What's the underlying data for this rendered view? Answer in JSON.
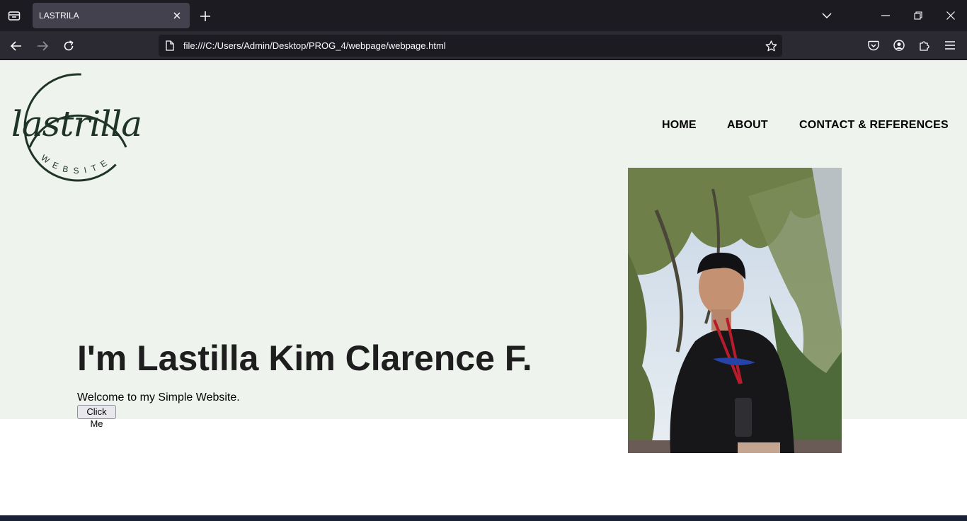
{
  "browser": {
    "tab_title": "LASTRILA",
    "url": "file:///C:/Users/Admin/Desktop/PROG_4/webpage/webpage.html",
    "icons": [
      "list-all-tabs-icon",
      "close-tab-icon",
      "new-tab-icon",
      "tab-overflow-icon",
      "minimize-icon",
      "restore-icon",
      "close-window-icon",
      "back-icon",
      "forward-icon",
      "reload-icon",
      "page-icon",
      "bookmark-star-icon",
      "pocket-icon",
      "account-icon",
      "extensions-icon",
      "menu-icon"
    ]
  },
  "page": {
    "logo": {
      "script": "lastrilla",
      "sub": "WEBSITE"
    },
    "nav": [
      "HOME",
      "ABOUT",
      "CONTACT & REFERENCES"
    ],
    "headline": "I'm Lastilla Kim Clarence F.",
    "welcome": "Welcome to my Simple Website.",
    "button_label": "Click Me",
    "photo_alt": "portrait photo",
    "colors": {
      "hero_bg": "#eef3ee",
      "logo": "#1f3326",
      "chrome_dark": "#1c1b22",
      "toolbar": "#2b2a33"
    }
  }
}
